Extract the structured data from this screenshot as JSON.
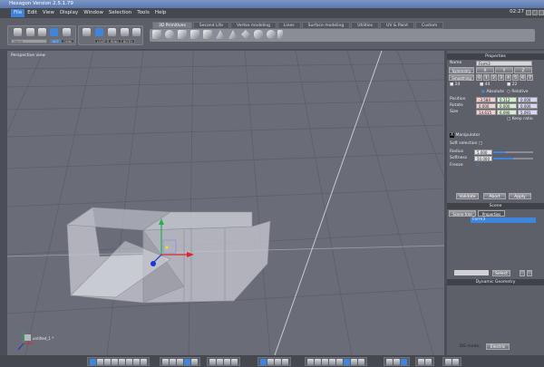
{
  "window": {
    "title": "Hexagon Version 2.5.1.79",
    "clock": "02:27"
  },
  "menu": [
    {
      "label": "File",
      "active": true
    },
    {
      "label": "Edit"
    },
    {
      "label": "View"
    },
    {
      "label": "Display"
    },
    {
      "label": "Window"
    },
    {
      "label": "Selection"
    },
    {
      "label": "Tools"
    },
    {
      "label": "Help"
    }
  ],
  "toolbar": {
    "tabs": [
      "3D Primitives",
      "Second Life",
      "Vertex modeling",
      "Lines",
      "Surface modeling",
      "Utilities",
      "UV & Paint",
      "Custom"
    ],
    "active_tab": "3D Primitives",
    "coord_dropdown": "World",
    "coord_buttons": [
      "ACT",
      "OMNI"
    ],
    "selection_buttons": [
      "LOOP",
      "RING",
      "BOTH"
    ]
  },
  "viewport": {
    "label": "Perspective view",
    "axis_label": "untitled_1 *"
  },
  "properties": {
    "title": "Properties",
    "name_label": "Name",
    "name_value": "Form3",
    "symmetry_label": "Symmetry",
    "symmetry_axes": [
      "X",
      "Y",
      "Z"
    ],
    "smoothing_label": "Smoothing",
    "smoothing_levels": [
      "0",
      "1",
      "2",
      "3",
      "4",
      "5",
      "6",
      "7"
    ],
    "counts": [
      "24",
      "44",
      "22"
    ],
    "absolute_label": "Absolute",
    "relative_label": "Relative",
    "position_label": "Position",
    "position": [
      "-3.584",
      "0.112",
      "0.000"
    ],
    "rotate_label": "Rotate",
    "rotate": [
      "0.000",
      "0.000",
      "0.000"
    ],
    "size_label": "Size",
    "size": [
      "14.615",
      "6.090",
      "5.091"
    ],
    "keep_ratio_label": "Keep ratio",
    "manipulator_label": "Manipulator",
    "soft_selection_label": "Soft selection",
    "radius_label": "Radius",
    "radius_value": "5.000",
    "radius_level": 0.3,
    "softness_label": "Softness",
    "softness_value": "50.000",
    "softness_level": 0.5,
    "freeze_label": "Freeze",
    "buttons": [
      "Validate",
      "Abort",
      "Apply"
    ]
  },
  "scene": {
    "title": "Scene",
    "tabs": [
      "Scene tree",
      "Properties"
    ],
    "items": [
      "Form3"
    ],
    "select_button": "Select"
  },
  "dynamic_geometry": {
    "title": "Dynamic Geometry",
    "dg_mode_label": "DG mode:",
    "dg_mode_value": "Electric"
  },
  "colors": {
    "accent": "#3d86db",
    "viewport": "#6a6d77",
    "panel": "#5d6069"
  }
}
